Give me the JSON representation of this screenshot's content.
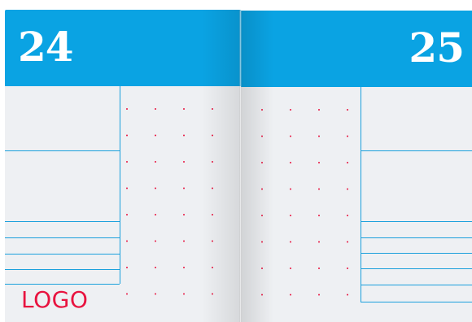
{
  "left_page": {
    "number": "24",
    "logo": "LOGO"
  },
  "right_page": {
    "number": "25"
  },
  "colors": {
    "header": "#0aa3e3",
    "rule": "#1ba0dc",
    "dot": "#e8133f",
    "paper": "#eef0f3",
    "logo": "#e8133f"
  }
}
